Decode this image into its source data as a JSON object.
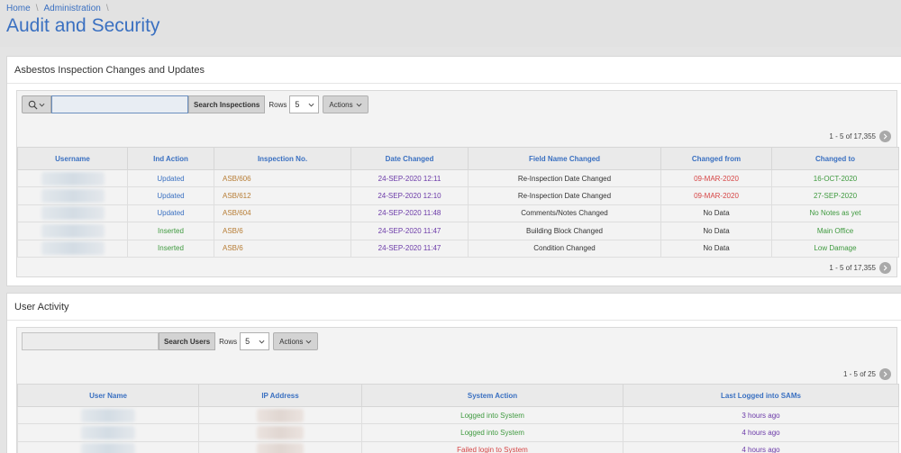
{
  "breadcrumb": {
    "home": "Home",
    "admin": "Administration",
    "sep": "\\"
  },
  "page": {
    "title": "Audit and Security"
  },
  "inspections": {
    "title": "Asbestos Inspection Changes and Updates",
    "search_button": "Search Inspections",
    "rows_label": "Rows",
    "rows_value": "5",
    "actions_label": "Actions",
    "pagination": "1 - 5 of 17,355",
    "headers": [
      "Username",
      "Ind Action",
      "Inspection No.",
      "Date Changed",
      "Field Name Changed",
      "Changed from",
      "Changed to"
    ],
    "rows": [
      {
        "action": "Updated",
        "inspection": "ASB/606",
        "date": "24-SEP-2020 12:11",
        "field": "Re-Inspection Date Changed",
        "from": "09-MAR-2020",
        "to": "16-OCT-2020"
      },
      {
        "action": "Updated",
        "inspection": "ASB/612",
        "date": "24-SEP-2020 12:10",
        "field": "Re-Inspection Date Changed",
        "from": "09-MAR-2020",
        "to": "27-SEP-2020"
      },
      {
        "action": "Updated",
        "inspection": "ASB/604",
        "date": "24-SEP-2020 11:48",
        "field": "Comments/Notes Changed",
        "from": "No Data",
        "to": "No Notes as yet"
      },
      {
        "action": "Inserted",
        "inspection": "ASB/6",
        "date": "24-SEP-2020 11:47",
        "field": "Building Block Changed",
        "from": "No Data",
        "to": "Main Office"
      },
      {
        "action": "Inserted",
        "inspection": "ASB/6",
        "date": "24-SEP-2020 11:47",
        "field": "Condition Changed",
        "from": "No Data",
        "to": "Low Damage"
      }
    ]
  },
  "activity": {
    "title": "User Activity",
    "search_button": "Search Users",
    "rows_label": "Rows",
    "rows_value": "5",
    "actions_label": "Actions",
    "pagination": "1 - 5 of 25",
    "headers": [
      "User Name",
      "IP Address",
      "System Action",
      "Last Logged into SAMs"
    ],
    "rows": [
      {
        "action": "Logged into System",
        "last": "3 hours ago"
      },
      {
        "action": "Logged into System",
        "last": "4 hours ago"
      },
      {
        "action": "Failed login to System",
        "last": "4 hours ago"
      }
    ]
  },
  "icons": {
    "search": "search-icon",
    "chevron": "chevron-down-icon",
    "next": "chevron-right-icon"
  }
}
